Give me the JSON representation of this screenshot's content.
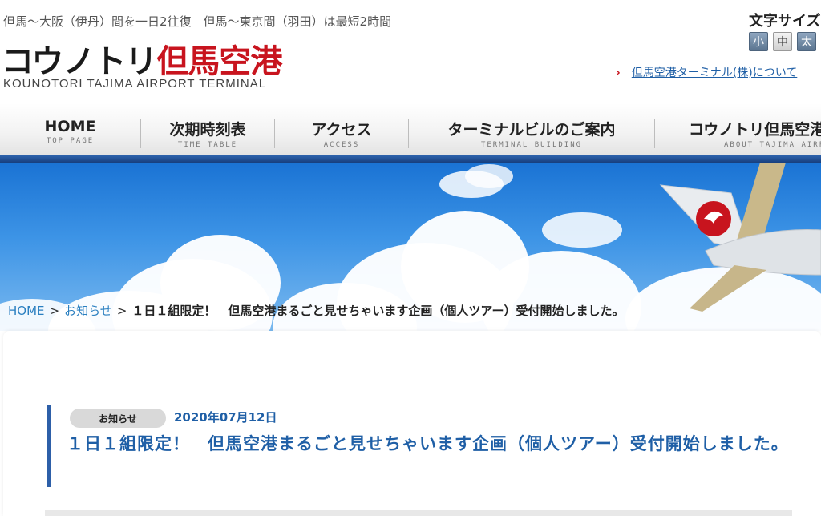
{
  "header": {
    "tagline": "但馬～大阪（伊丹）間を一日2往復　但馬～東京間（羽田）は最短2時間",
    "logo_black": "コウノトリ",
    "logo_red": "但馬空港",
    "logo_en": "KOUNOTORI TAJIMA AIRPORT TERMINAL",
    "font_size_label": "文字サイズ",
    "font_size_buttons": [
      "小",
      "中",
      "太"
    ],
    "about_arrow": "›",
    "about_link": "但馬空港ターミナル(株)について"
  },
  "nav": [
    {
      "jp": "HOME",
      "en": "TOP PAGE"
    },
    {
      "jp": "次期時刻表",
      "en": "TIME TABLE"
    },
    {
      "jp": "アクセス",
      "en": "ACCESS"
    },
    {
      "jp": "ターミナルビルのご案内",
      "en": "TERMINAL BUILDING"
    },
    {
      "jp": "コウノトリ但馬空港",
      "en": "ABOUT TAJIMA AIRPORT"
    }
  ],
  "breadcrumb": {
    "home": "HOME",
    "news": "お知らせ",
    "sep": ">",
    "current": "１日１組限定！　但馬空港まるごと見せちゃいます企画（個人ツアー）受付開始しました。"
  },
  "article": {
    "badge": "お知らせ",
    "date": "2020年07月12日",
    "title": "１日１組限定！　但馬空港まるごと見せちゃいます企画（個人ツアー）受付開始しました。"
  },
  "colors": {
    "brand_red": "#c8141e",
    "nav_blue": "#2d63ad",
    "link_blue": "#1f5fa6"
  }
}
